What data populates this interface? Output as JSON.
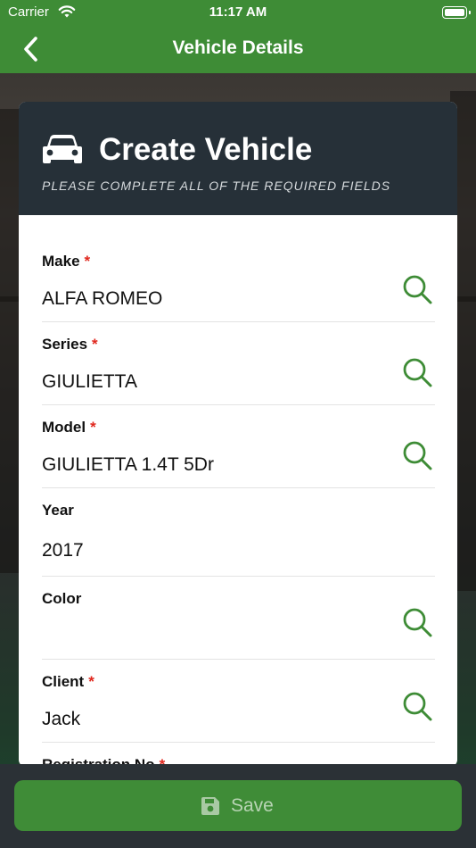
{
  "status_bar": {
    "carrier": "Carrier",
    "time": "11:17 AM"
  },
  "nav": {
    "title": "Vehicle Details",
    "back_icon": "chevron-left-icon"
  },
  "card": {
    "title": "Create Vehicle",
    "subtitle": "PLEASE COMPLETE ALL OF THE REQUIRED FIELDS",
    "icon": "car-icon"
  },
  "fields": [
    {
      "label": "Make",
      "required": "*",
      "value": "ALFA ROMEO",
      "searchable": true
    },
    {
      "label": "Series",
      "required": "*",
      "value": "GIULIETTA",
      "searchable": true
    },
    {
      "label": "Model",
      "required": "*",
      "value": "GIULIETTA 1.4T 5Dr",
      "searchable": true
    },
    {
      "label": "Year",
      "required": "",
      "value": "2017",
      "searchable": false
    },
    {
      "label": "Color",
      "required": "",
      "value": "",
      "searchable": true
    },
    {
      "label": "Client",
      "required": "*",
      "value": "Jack",
      "searchable": true
    },
    {
      "label": "Registration No",
      "required": "*",
      "value": "",
      "searchable": false
    }
  ],
  "save": {
    "label": "Save",
    "icon": "floppy-disk-icon"
  },
  "colors": {
    "brand_green": "#3e8c36",
    "header_dark": "#263038",
    "required_red": "#e0261c",
    "icon_green": "#3e8c36"
  }
}
